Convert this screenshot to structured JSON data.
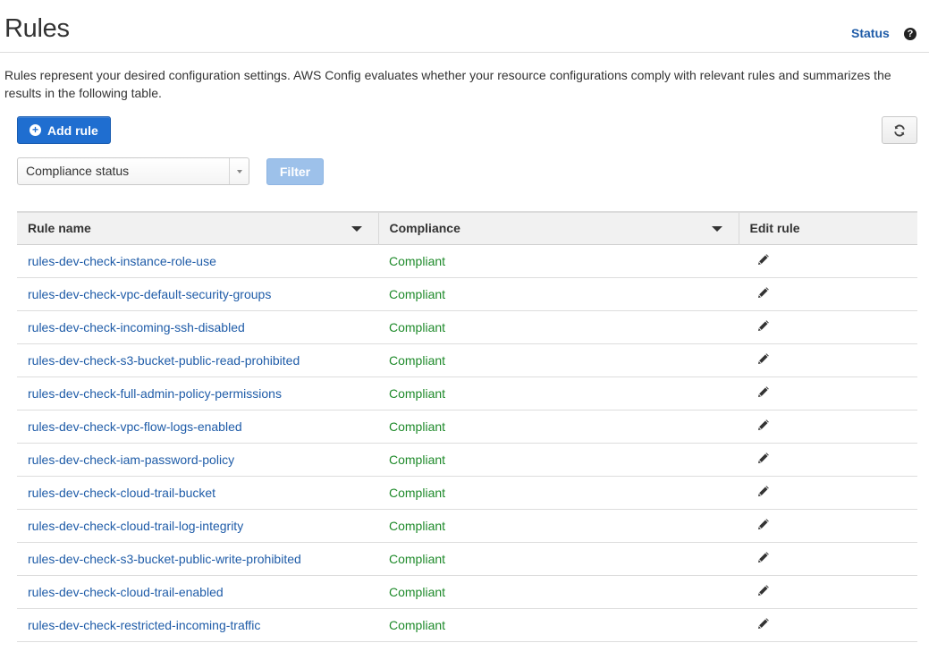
{
  "header": {
    "title": "Rules",
    "status_label": "Status",
    "help_icon": "?"
  },
  "description": "Rules represent your desired configuration settings. AWS Config evaluates whether your resource configurations comply with relevant rules and summarizes the results in the following table.",
  "toolbar": {
    "add_rule_label": "Add rule",
    "add_rule_icon": "plus-circle-icon",
    "refresh_icon": "refresh-icon",
    "filter_select_value": "Compliance status",
    "filter_label": "Filter"
  },
  "table": {
    "columns": [
      "Rule name",
      "Compliance",
      "Edit rule"
    ],
    "rows": [
      {
        "name": "rules-dev-check-instance-role-use",
        "compliance": "Compliant"
      },
      {
        "name": "rules-dev-check-vpc-default-security-groups",
        "compliance": "Compliant"
      },
      {
        "name": "rules-dev-check-incoming-ssh-disabled",
        "compliance": "Compliant"
      },
      {
        "name": "rules-dev-check-s3-bucket-public-read-prohibited",
        "compliance": "Compliant"
      },
      {
        "name": "rules-dev-check-full-admin-policy-permissions",
        "compliance": "Compliant"
      },
      {
        "name": "rules-dev-check-vpc-flow-logs-enabled",
        "compliance": "Compliant"
      },
      {
        "name": "rules-dev-check-iam-password-policy",
        "compliance": "Compliant"
      },
      {
        "name": "rules-dev-check-cloud-trail-bucket",
        "compliance": "Compliant"
      },
      {
        "name": "rules-dev-check-cloud-trail-log-integrity",
        "compliance": "Compliant"
      },
      {
        "name": "rules-dev-check-s3-bucket-public-write-prohibited",
        "compliance": "Compliant"
      },
      {
        "name": "rules-dev-check-cloud-trail-enabled",
        "compliance": "Compliant"
      },
      {
        "name": "rules-dev-check-restricted-incoming-traffic",
        "compliance": "Compliant"
      }
    ]
  },
  "colors": {
    "link": "#1f5ca8",
    "compliant": "#1e8a2a",
    "primary_button": "#1f6ed0",
    "disabled_button": "#9dc1ea"
  }
}
